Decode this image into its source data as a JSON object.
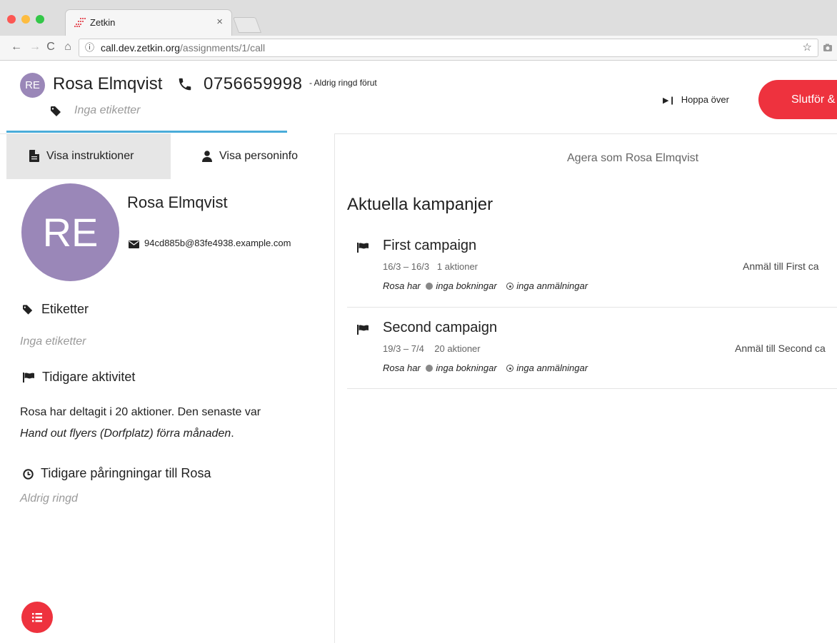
{
  "browser": {
    "tab_title": "Zetkin",
    "tab_close": "×",
    "url_host": "call.dev.zetkin.org",
    "url_path": "/assignments/1/call",
    "nav": {
      "back": "←",
      "forward": "→",
      "reload": "C",
      "home": "⌂"
    },
    "star": "☆",
    "info": "ⓘ"
  },
  "header": {
    "avatar_initials": "RE",
    "name": "Rosa Elmqvist",
    "phone": "0756659998",
    "call_status": "- Aldrig ringd förut",
    "tags": "Inga etiketter",
    "skip_label": "Hoppa över",
    "finish_label": "Slutför &"
  },
  "left": {
    "tabs": {
      "instructions": "Visa instruktioner",
      "person_info": "Visa personinfo"
    },
    "avatar_initials": "RE",
    "name": "Rosa Elmqvist",
    "email": "94cd885b@83fe4938.example.com",
    "tags_heading": "Etiketter",
    "tags_empty": "Inga etiketter",
    "activity_heading": "Tidigare aktivitet",
    "activity_text_1": "Rosa har deltagit i 20 aktioner. Den senaste var",
    "activity_last_action": "Hand out flyers (Dorfplatz)",
    "activity_when": "förra månaden",
    "activity_end": ".",
    "calls_heading": "Tidigare påringningar till Rosa",
    "calls_empty": "Aldrig ringd"
  },
  "right": {
    "act_as": "Agera som Rosa Elmqvist",
    "campaigns_heading": "Aktuella kampanjer",
    "campaigns": [
      {
        "title": "First campaign",
        "dates": "16/3 – 16/3",
        "actions": "1 aktioner",
        "signup": "Anmäl till First ca",
        "status_prefix": "Rosa har",
        "bookings": "inga bokningar",
        "signups": "inga anmälningar"
      },
      {
        "title": "Second campaign",
        "dates": "19/3 – 7/4",
        "actions": "20 aktioner",
        "signup": "Anmäl till Second ca",
        "status_prefix": "Rosa har",
        "bookings": "inga bokningar",
        "signups": "inga anmälningar"
      }
    ]
  },
  "colors": {
    "accent_red": "#ee323e",
    "avatar_purple": "#9a87b8",
    "progress_blue": "#4aacd9"
  },
  "icons": [
    "phone-icon",
    "tag-icon",
    "skip-icon",
    "document-icon",
    "user-icon",
    "envelope-icon",
    "flag-icon",
    "clock-icon",
    "list-icon"
  ]
}
